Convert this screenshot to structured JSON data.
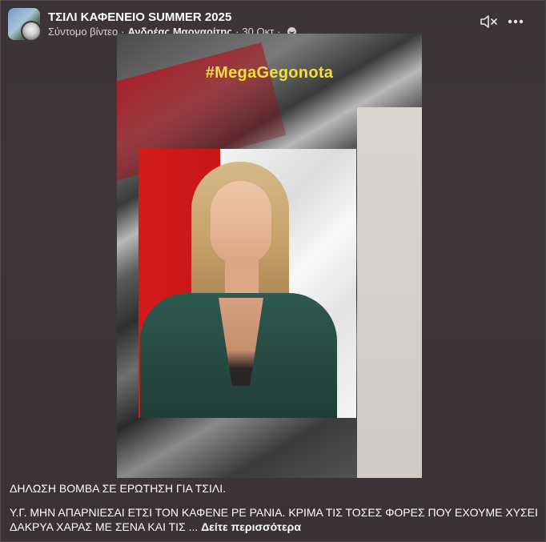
{
  "header": {
    "group_title": "ΤΣΙΛΙ ΚΑΦΕΝΕΙΟ SUMMER 2025",
    "post_type": "Σύντομο βίντεο",
    "author": "Ανδρέας Μαργαρίτης",
    "date": "30 Οκτ",
    "separator": "·",
    "audience_icon": "globe-icon"
  },
  "actions": {
    "mute_icon": "speaker-muted-icon",
    "more_icon": "more-dots-icon"
  },
  "video": {
    "hashtag": "#MegaGegonota"
  },
  "caption": {
    "title": "ΔΗΛΩΣΗ ΒΟΜΒΑ ΣΕ ΕΡΩΤΗΣΗ ΓΙΑ ΤΣΙΛΙ.",
    "body": "Υ.Γ. ΜΗΝ ΑΠΑΡΝΙΕΣΑΙ ΕΤΣΙ ΤΟΝ ΚΑΦΕΝΕ ΡΕ ΡΑΝΙΑ. ΚΡΙΜΑ ΤΙΣ ΤΟΣΕΣ ΦΟΡΕΣ ΠΟΥ ΕΧΟΥΜΕ ΧΥΣΕΙ ΔΑΚΡΥΑ ΧΑΡΑΣ ΜΕ ΣΕΝΑ ΚΑΙ ΤΙΣ ...",
    "see_more": "Δείτε περισσότερα"
  },
  "colors": {
    "background": "#3b3436",
    "hashtag_yellow": "#f2df3a",
    "jacket_green": "#2f5a4f",
    "studio_red": "#d31a1a"
  }
}
